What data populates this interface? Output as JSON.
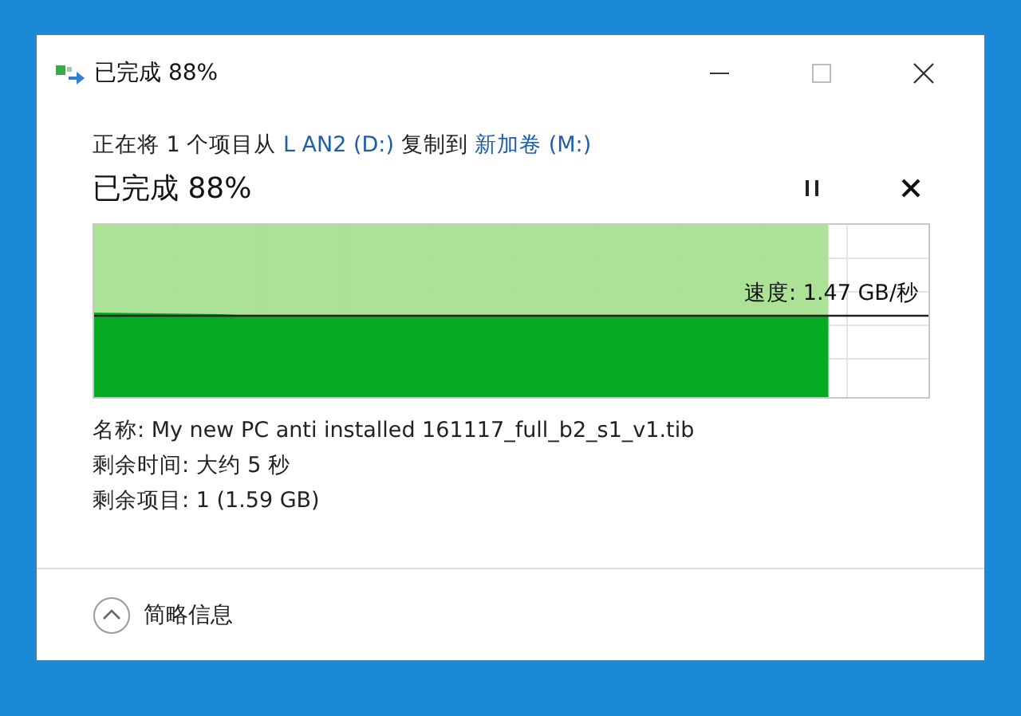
{
  "window": {
    "title": "已完成 88%"
  },
  "copy_line": [
    {
      "kind": "text",
      "text": "正在将 1 个项目从"
    },
    {
      "kind": "link",
      "text": "L AN2 (D:)"
    },
    {
      "kind": "text",
      "text": "复制到"
    },
    {
      "kind": "link",
      "text": "新加卷 (M:)"
    }
  ],
  "status": "已完成 88%",
  "progress": {
    "level": 0.88,
    "speed": "速度: 1.47 GB/秒"
  },
  "details": [
    "名称: My new PC anti installed 161117_full_b2_s1_v1.tib",
    "剩余时间: 大约 5 秒",
    "剩余项目: 1 (1.59 GB)"
  ],
  "footer": {
    "label": "简略信息",
    "expanded": true
  }
}
